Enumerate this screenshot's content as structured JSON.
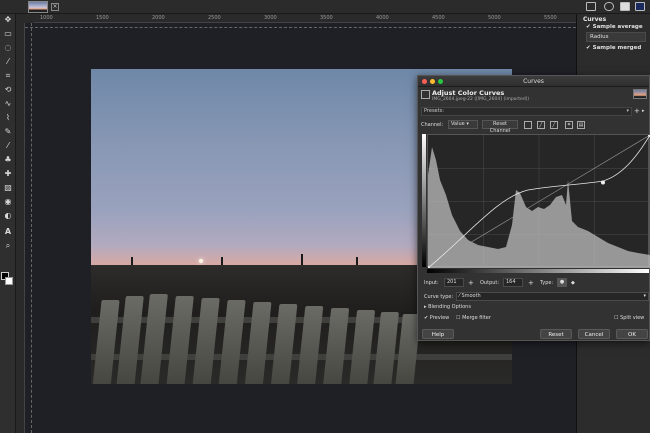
{
  "ruler": {
    "ticks": [
      "1000",
      "1500",
      "2000",
      "2500",
      "3000",
      "3500",
      "4000",
      "4500",
      "5000",
      "5500"
    ]
  },
  "tool_options": {
    "title": "Curves",
    "sample_average": "Sample average",
    "radius_label": "Radius",
    "sample_merged": "Sample merged"
  },
  "dialog": {
    "window_title": "Curves",
    "heading": "Adjust Color Curves",
    "subtitle": "IMG_2604.jpeg-22 ([IMG_2604] (imported))",
    "presets_label": "Presets:",
    "channel_label": "Channel:",
    "channel_value": "Value",
    "reset_channel": "Reset Channel",
    "input_label": "Input:",
    "input_value": "201",
    "output_label": "Output:",
    "output_value": "164",
    "type_label": "Type:",
    "curve_type_label": "Curve type:",
    "curve_type_value": "Smooth",
    "blending_options": "Blending Options",
    "preview": "Preview",
    "merge_filter": "Merge filter",
    "split_view": "Split view",
    "help": "Help",
    "reset": "Reset",
    "cancel": "Cancel",
    "ok": "OK"
  },
  "colors": {
    "accent": "#2f6fd6",
    "close": "#ff5f57",
    "minimize": "#febc2e",
    "zoom": "#28c840"
  },
  "curve_points": [
    {
      "input": 0,
      "output": 0
    },
    {
      "input": 201,
      "output": 164
    },
    {
      "input": 255,
      "output": 255
    }
  ]
}
